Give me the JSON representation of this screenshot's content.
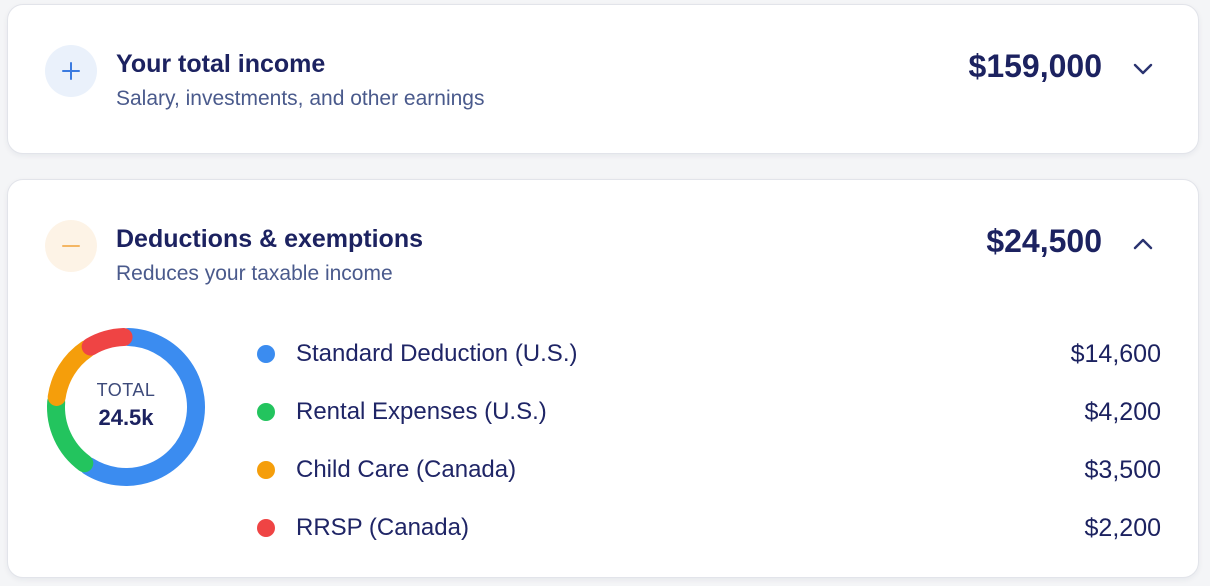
{
  "income": {
    "title": "Your total income",
    "subtitle": "Salary, investments, and other earnings",
    "amount": "$159,000",
    "icon": "plus-icon",
    "toggle_icon": "chevron-down-icon",
    "expanded": false
  },
  "deductions": {
    "title": "Deductions & exemptions",
    "subtitle": "Reduces your taxable income",
    "amount": "$24,500",
    "icon": "minus-icon",
    "toggle_icon": "chevron-up-icon",
    "expanded": true,
    "donut": {
      "label": "TOTAL",
      "value": "24.5k"
    },
    "items": [
      {
        "label": "Standard Deduction (U.S.)",
        "value": "$14,600",
        "amount": 14600,
        "color": "#3b8cf0"
      },
      {
        "label": "Rental Expenses (U.S.)",
        "value": "$4,200",
        "amount": 4200,
        "color": "#23c45e"
      },
      {
        "label": "Child Care (Canada)",
        "value": "$3,500",
        "amount": 3500,
        "color": "#f59e0b"
      },
      {
        "label": "RRSP (Canada)",
        "value": "$2,200",
        "amount": 2200,
        "color": "#ef4444"
      }
    ]
  },
  "colors": {
    "accent_blue": "#3b8cf0",
    "accent_orange": "#f4b664",
    "text_primary": "#1c2260",
    "text_secondary": "#4a5a8c"
  }
}
